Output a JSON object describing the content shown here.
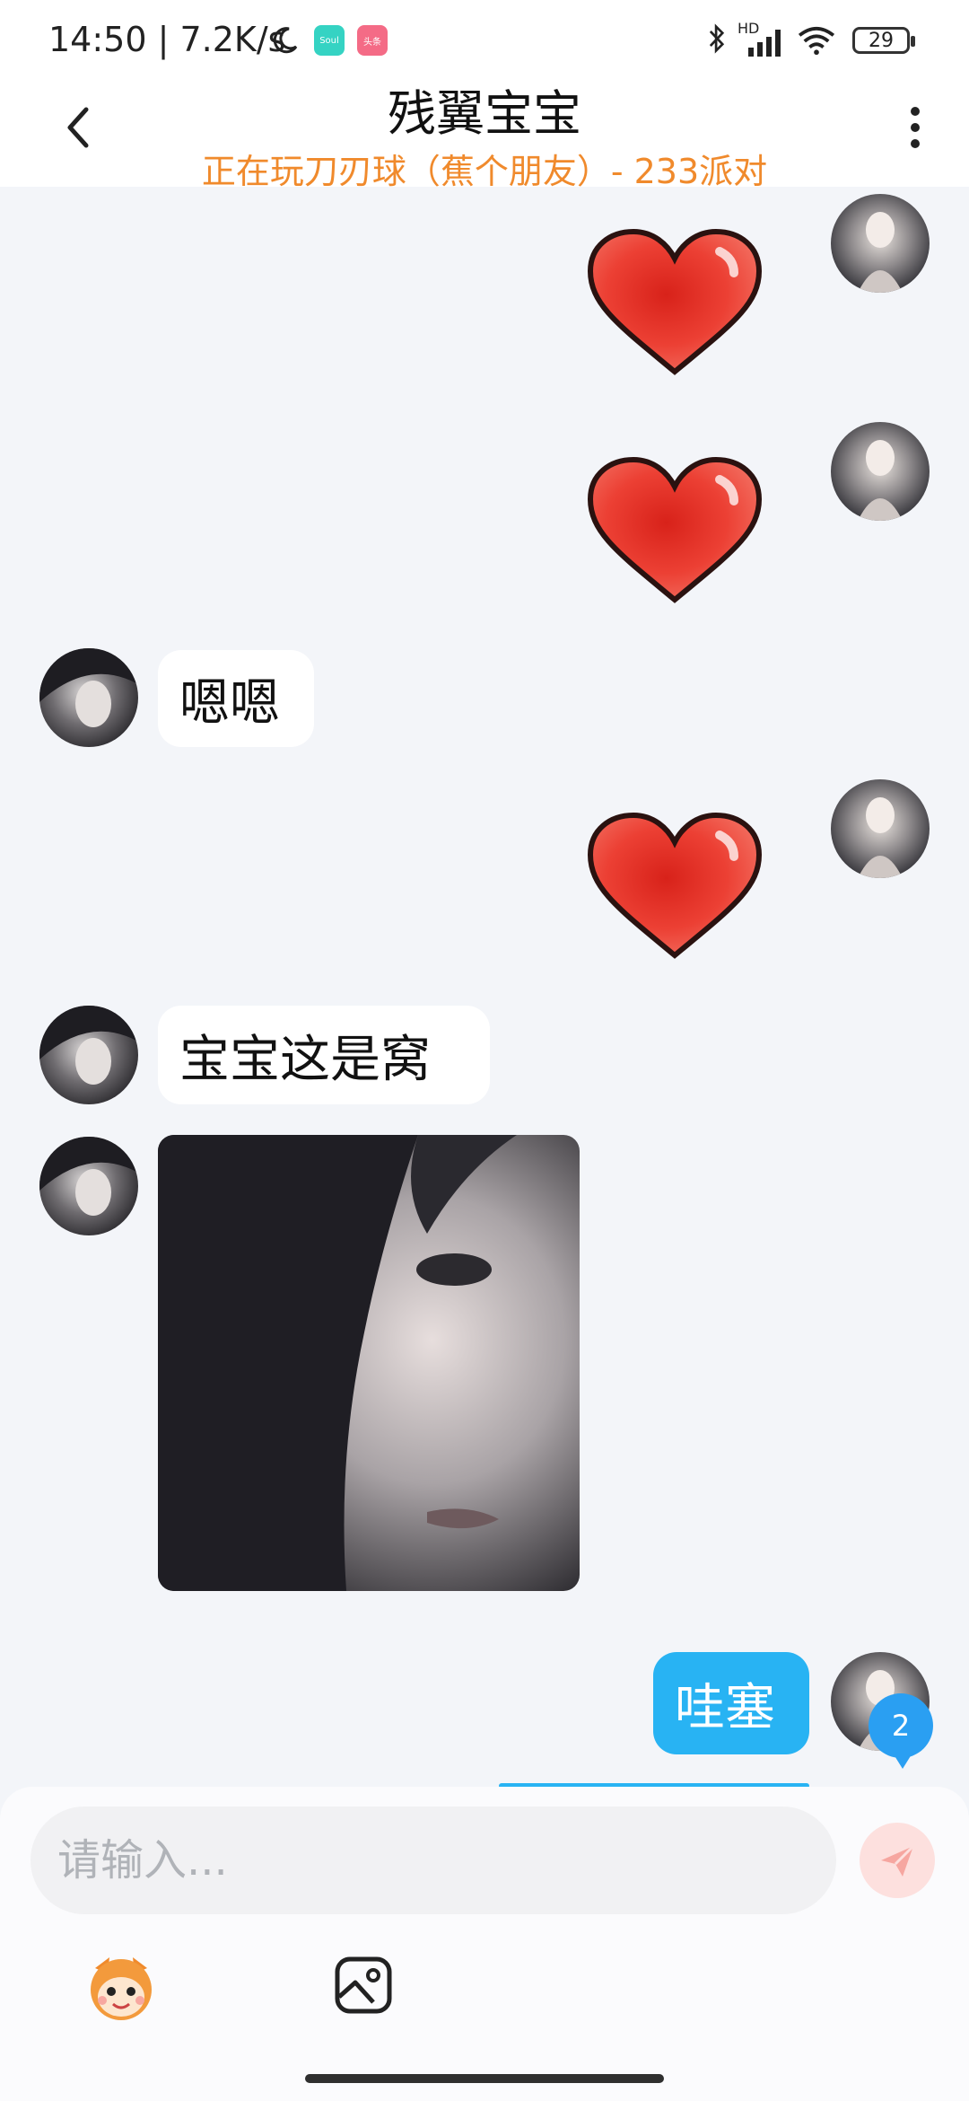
{
  "status_bar": {
    "time_speed": "14:50 | 7.2K/s",
    "app_chip_1": "Soul",
    "app_chip_2": "头条",
    "signal_label": "HD",
    "battery": "29"
  },
  "header": {
    "title": "残翼宝宝",
    "subtitle": "正在玩刀刃球（蕉个朋友）- 233派对"
  },
  "messages": [
    {
      "side": "mine",
      "type": "heart"
    },
    {
      "side": "mine",
      "type": "heart"
    },
    {
      "side": "theirs",
      "type": "text",
      "text": "嗯嗯"
    },
    {
      "side": "mine",
      "type": "heart"
    },
    {
      "side": "theirs",
      "type": "text",
      "text": "宝宝这是窝"
    },
    {
      "side": "theirs",
      "type": "image"
    },
    {
      "side": "mine",
      "type": "text",
      "text": "哇塞"
    }
  ],
  "unread_badge": "2",
  "input": {
    "placeholder": "请输入..."
  },
  "colors": {
    "accent_blue": "#28b3f3",
    "subtitle_orange": "#f08a2c",
    "heart_red": "#e93b2e"
  },
  "icons": [
    "back-icon",
    "more-icon",
    "send-icon",
    "mascot-emoji-icon",
    "gallery-icon"
  ]
}
